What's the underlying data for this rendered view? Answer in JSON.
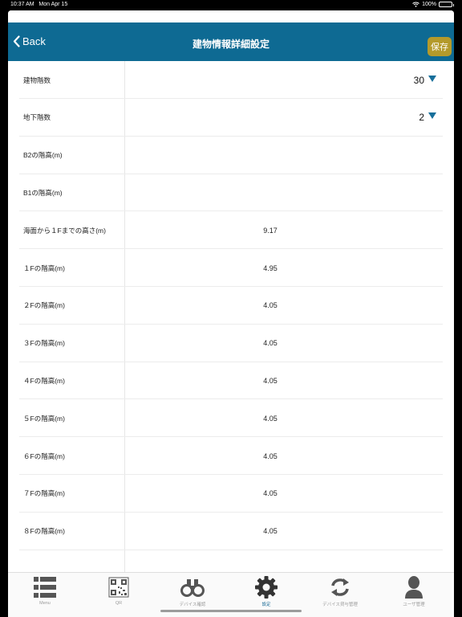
{
  "status_bar": {
    "time": "10:37 AM",
    "date": "Mon Apr 15",
    "battery": "100%"
  },
  "navbar": {
    "back_label": "Back",
    "title": "建物情報詳細設定",
    "save_label": "保存"
  },
  "rows": [
    {
      "label": "建物階数",
      "value": "30",
      "type": "dropdown"
    },
    {
      "label": "地下階数",
      "value": "2",
      "type": "dropdown"
    },
    {
      "label": "B2の階高(m)",
      "value": "",
      "type": "text"
    },
    {
      "label": "B1の階高(m)",
      "value": "",
      "type": "text"
    },
    {
      "label": "海面から１Fまでの高さ(m)",
      "value": "9.17",
      "type": "text"
    },
    {
      "label": "１Fの階高(m)",
      "value": "4.95",
      "type": "text"
    },
    {
      "label": "２Fの階高(m)",
      "value": "4.05",
      "type": "text"
    },
    {
      "label": "３Fの階高(m)",
      "value": "4.05",
      "type": "text"
    },
    {
      "label": "４Fの階高(m)",
      "value": "4.05",
      "type": "text"
    },
    {
      "label": "５Fの階高(m)",
      "value": "4.05",
      "type": "text"
    },
    {
      "label": "６Fの階高(m)",
      "value": "4.05",
      "type": "text"
    },
    {
      "label": "７Fの階高(m)",
      "value": "4.05",
      "type": "text"
    },
    {
      "label": "８Fの階高(m)",
      "value": "4.05",
      "type": "text"
    }
  ],
  "tabs": [
    {
      "label": "Menu",
      "icon": "menu-icon"
    },
    {
      "label": "QR",
      "icon": "qr-code-icon"
    },
    {
      "label": "デバイス確認",
      "icon": "binoculars-icon"
    },
    {
      "label": "設定",
      "icon": "gear-icon",
      "active": true
    },
    {
      "label": "デバイス貸与管理",
      "icon": "sync-icon"
    },
    {
      "label": "ユーザ管理",
      "icon": "user-icon"
    }
  ],
  "colors": {
    "navbar": "#0e6a93",
    "save_button": "#b49a2b",
    "accent": "#176f9b"
  }
}
